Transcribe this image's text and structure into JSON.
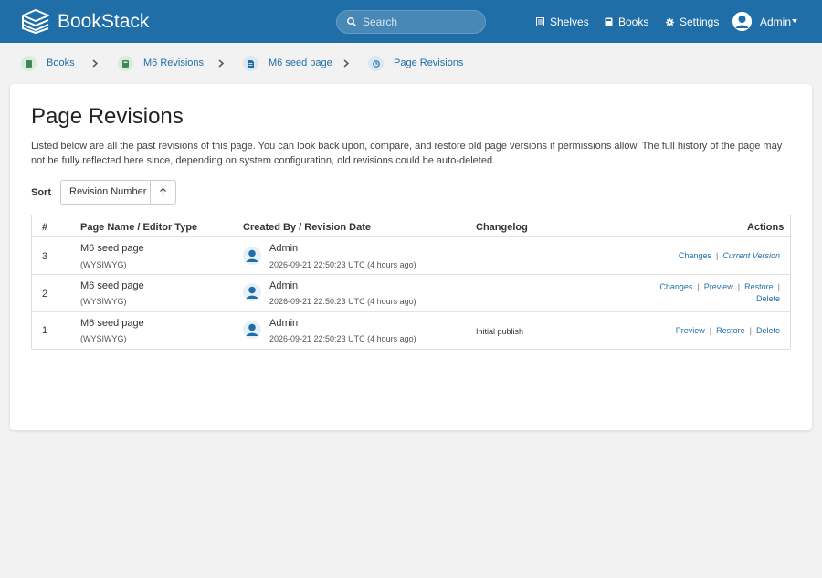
{
  "header": {
    "brand": "BookStack",
    "search_placeholder": "Search",
    "nav": [
      {
        "label": "Shelves",
        "icon": "shelves-icon"
      },
      {
        "label": "Books",
        "icon": "books-icon"
      },
      {
        "label": "Settings",
        "icon": "settings-icon"
      }
    ],
    "user": "Admin"
  },
  "breadcrumbs": [
    {
      "label": "Books",
      "icon": "books-icon",
      "icon_bg": "#dcebd9",
      "icon_color": "#3b8a57"
    },
    {
      "label": "M6 Revisions",
      "icon": "book-icon",
      "icon_bg": "#dcebd9",
      "icon_color": "#3b8a57"
    },
    {
      "label": "M6 seed page",
      "icon": "page-icon",
      "icon_bg": "#dbe7f3",
      "icon_color": "#206ea7"
    },
    {
      "label": "Page Revisions",
      "icon": "revision-icon",
      "icon_bg": "#dbe7f3",
      "icon_color": "#206ea7"
    }
  ],
  "main": {
    "title": "Page Revisions",
    "description": "Listed below are all the past revisions of this page. You can look back upon, compare, and restore old page versions if permissions allow. The full history of the page may not be fully reflected here since, depending on system configuration, old revisions could be auto-deleted.",
    "sort": {
      "label": "Sort",
      "value": "Revision Number",
      "direction_icon": "arrow-up-icon"
    }
  },
  "table": {
    "headers": [
      "#",
      "Page Name / Editor Type",
      "Created By / Revision Date",
      "Changelog",
      "Actions"
    ],
    "rows": [
      {
        "num": "3",
        "page": "M6 seed page",
        "editor": "(WYSIWYG)",
        "user": "Admin",
        "date": "2026-09-21 22:50:23 UTC (4 hours ago)",
        "changelog": "",
        "actions": [
          "Changes",
          "Current Version"
        ]
      },
      {
        "num": "2",
        "page": "M6 seed page",
        "editor": "(WYSIWYG)",
        "user": "Admin",
        "date": "2026-09-21 22:50:23 UTC (4 hours ago)",
        "changelog": "",
        "actions": [
          "Changes",
          "Preview",
          "Restore",
          "Delete"
        ]
      },
      {
        "num": "1",
        "page": "M6 seed page",
        "editor": "(WYSIWYG)",
        "user": "Admin",
        "date": "2026-09-21 22:50:23 UTC (4 hours ago)",
        "changelog": "Initial publish",
        "actions": [
          "Preview",
          "Restore",
          "Delete"
        ]
      }
    ]
  },
  "colors": {
    "primary": "#206ea7",
    "background": "#f2f2f2",
    "avatar": "#206ea7"
  }
}
